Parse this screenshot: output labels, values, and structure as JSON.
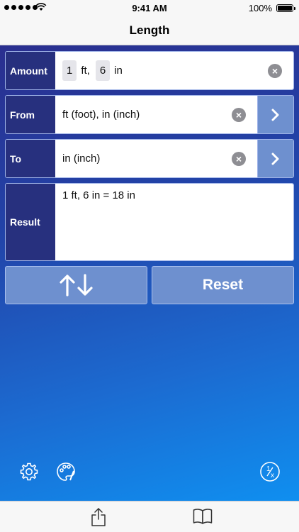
{
  "status_bar": {
    "time": "9:41 AM",
    "battery": "100%"
  },
  "nav": {
    "title": "Length"
  },
  "amount": {
    "label": "Amount",
    "parts": [
      {
        "value": "1",
        "unit": "ft,"
      },
      {
        "value": "6",
        "unit": "in"
      }
    ]
  },
  "from": {
    "label": "From",
    "value": "ft (foot), in (inch)"
  },
  "to": {
    "label": "To",
    "value": "in (inch)"
  },
  "result": {
    "label": "Result",
    "value": "1 ft, 6 in = 18 in"
  },
  "actions": {
    "swap_label": "↑↓",
    "reset_label": "Reset"
  },
  "icons": {
    "settings": "gear-icon",
    "theme": "palette-icon",
    "fraction": "fraction-icon",
    "share": "share-icon",
    "book": "book-icon"
  },
  "colors": {
    "label_bg": "#27307e",
    "button_bg": "#6e90cf",
    "gradient_top": "#2a2f8f",
    "gradient_bottom": "#0f8ff0"
  }
}
